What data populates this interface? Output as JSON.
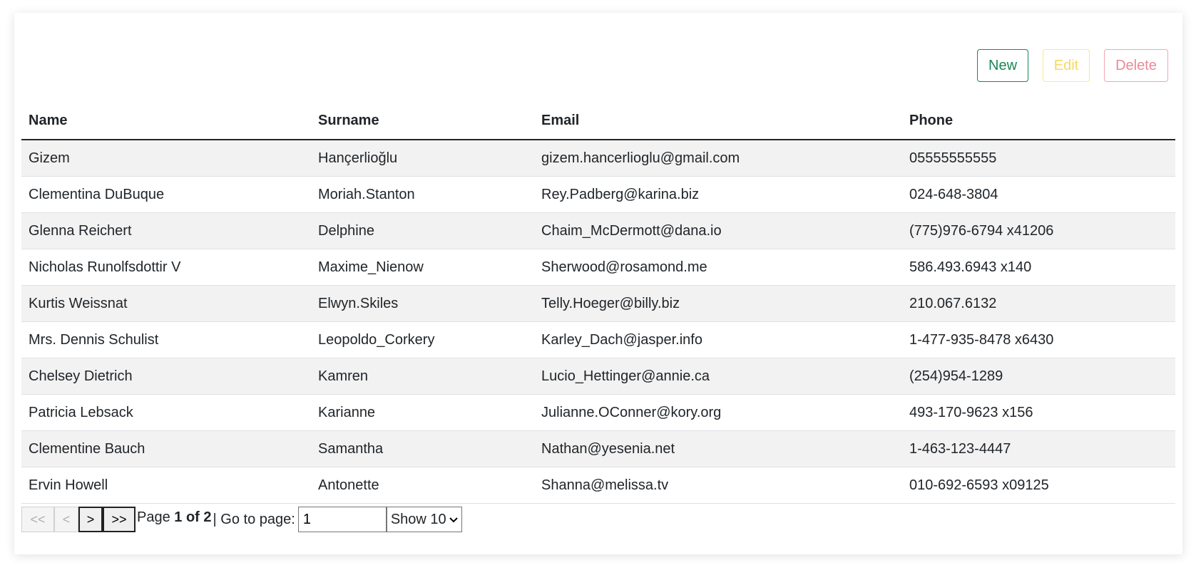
{
  "toolbar": {
    "new_label": "New",
    "edit_label": "Edit",
    "delete_label": "Delete"
  },
  "table": {
    "columns": [
      "Name",
      "Surname",
      "Email",
      "Phone"
    ],
    "rows": [
      [
        "Gizem",
        "Hançerlioğlu",
        "gizem.hancerlioglu@gmail.com",
        "05555555555"
      ],
      [
        "Clementina DuBuque",
        "Moriah.Stanton",
        "Rey.Padberg@karina.biz",
        "024-648-3804"
      ],
      [
        "Glenna Reichert",
        "Delphine",
        "Chaim_McDermott@dana.io",
        "(775)976-6794 x41206"
      ],
      [
        "Nicholas Runolfsdottir V",
        "Maxime_Nienow",
        "Sherwood@rosamond.me",
        "586.493.6943 x140"
      ],
      [
        "Kurtis Weissnat",
        "Elwyn.Skiles",
        "Telly.Hoeger@billy.biz",
        "210.067.6132"
      ],
      [
        "Mrs. Dennis Schulist",
        "Leopoldo_Corkery",
        "Karley_Dach@jasper.info",
        "1-477-935-8478 x6430"
      ],
      [
        "Chelsey Dietrich",
        "Kamren",
        "Lucio_Hettinger@annie.ca",
        "(254)954-1289"
      ],
      [
        "Patricia Lebsack",
        "Karianne",
        "Julianne.OConner@kory.org",
        "493-170-9623 x156"
      ],
      [
        "Clementine Bauch",
        "Samantha",
        "Nathan@yesenia.net",
        "1-463-123-4447"
      ],
      [
        "Ervin Howell",
        "Antonette",
        "Shanna@melissa.tv",
        "010-692-6593 x09125"
      ]
    ]
  },
  "pager": {
    "first_label": "<<",
    "prev_label": "<",
    "next_label": ">",
    "last_label": ">>",
    "page_prefix": "Page",
    "page_status": "1 of 2",
    "goto_label": "| Go to page:",
    "goto_value": "1",
    "show_value": "Show 10"
  },
  "colors": {
    "new": "#198754",
    "edit": "#f7d862",
    "delete": "#e98a96",
    "stripe": "#f2f2f2"
  }
}
